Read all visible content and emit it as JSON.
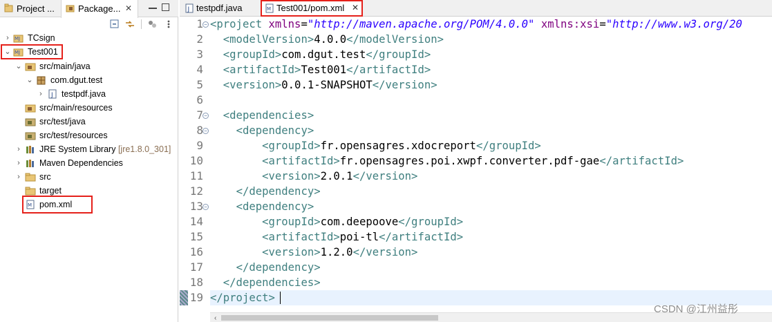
{
  "explorer": {
    "tabs": [
      {
        "label": "Project ..."
      },
      {
        "label": "Package..."
      }
    ],
    "close_glyph": "✕",
    "tree": [
      {
        "label": "TCsign",
        "icon": "maven-project-icon",
        "twistie": "›"
      },
      {
        "label": "Test001",
        "icon": "maven-project-icon",
        "twistie": "⌄"
      },
      {
        "label": "src/main/java",
        "icon": "source-folder-icon",
        "twistie": "⌄"
      },
      {
        "label": "com.dgut.test",
        "icon": "package-icon",
        "twistie": "⌄"
      },
      {
        "label": "testpdf.java",
        "icon": "java-file-icon",
        "twistie": "›"
      },
      {
        "label": "src/main/resources",
        "icon": "source-folder-icon",
        "twistie": ""
      },
      {
        "label": "src/test/java",
        "icon": "source-folder-icon",
        "twistie": ""
      },
      {
        "label": "src/test/resources",
        "icon": "source-folder-icon",
        "twistie": ""
      },
      {
        "label": "JRE System Library",
        "decoration": "[jre1.8.0_301]",
        "icon": "library-icon",
        "twistie": "›"
      },
      {
        "label": "Maven Dependencies",
        "icon": "library-icon",
        "twistie": "›"
      },
      {
        "label": "src",
        "icon": "folder-icon",
        "twistie": "›"
      },
      {
        "label": "target",
        "icon": "folder-icon",
        "twistie": ""
      },
      {
        "label": "pom.xml",
        "icon": "xml-file-icon",
        "twistie": ""
      }
    ]
  },
  "editor": {
    "tabs": [
      {
        "label": "testpdf.java",
        "icon": "java-file-icon"
      },
      {
        "label": "Test001/pom.xml",
        "icon": "xml-file-icon",
        "active": true
      }
    ],
    "close_glyph": "✕",
    "line_numbers": [
      "1",
      "2",
      "3",
      "4",
      "5",
      "6",
      "7",
      "8",
      "9",
      "10",
      "11",
      "12",
      "13",
      "14",
      "15",
      "16",
      "17",
      "18",
      "19"
    ],
    "fold_lines": [
      "1",
      "7",
      "8",
      "13"
    ],
    "code": {
      "l1_tag": "<project",
      "l1_attr1": "xmlns",
      "l1_val1": "\"http://maven.apache.org/POM/4.0.0\"",
      "l1_attr2": "xmlns:xsi",
      "l1_val2": "\"http://www.w3.org/20",
      "modelVersion": "4.0.0",
      "groupId": "com.dgut.test",
      "artifactId": "Test001",
      "version": "0.0.1-SNAPSHOT",
      "dep1_groupId": "fr.opensagres.xdocreport",
      "dep1_artifactId": "fr.opensagres.poi.xwpf.converter.pdf-gae",
      "dep1_version": "2.0.1",
      "dep2_groupId": "com.deepoove",
      "dep2_artifactId": "poi-tl",
      "dep2_version": "1.2.0",
      "project_close": "</project>"
    }
  },
  "colors": {
    "highlight_box": "#e5201a",
    "xml_tag": "#3f7f7f",
    "xml_attr": "#7f007f",
    "xml_value": "#2a00ff",
    "current_line": "#e8f2fe"
  },
  "watermark": "CSDN @江州益彤"
}
